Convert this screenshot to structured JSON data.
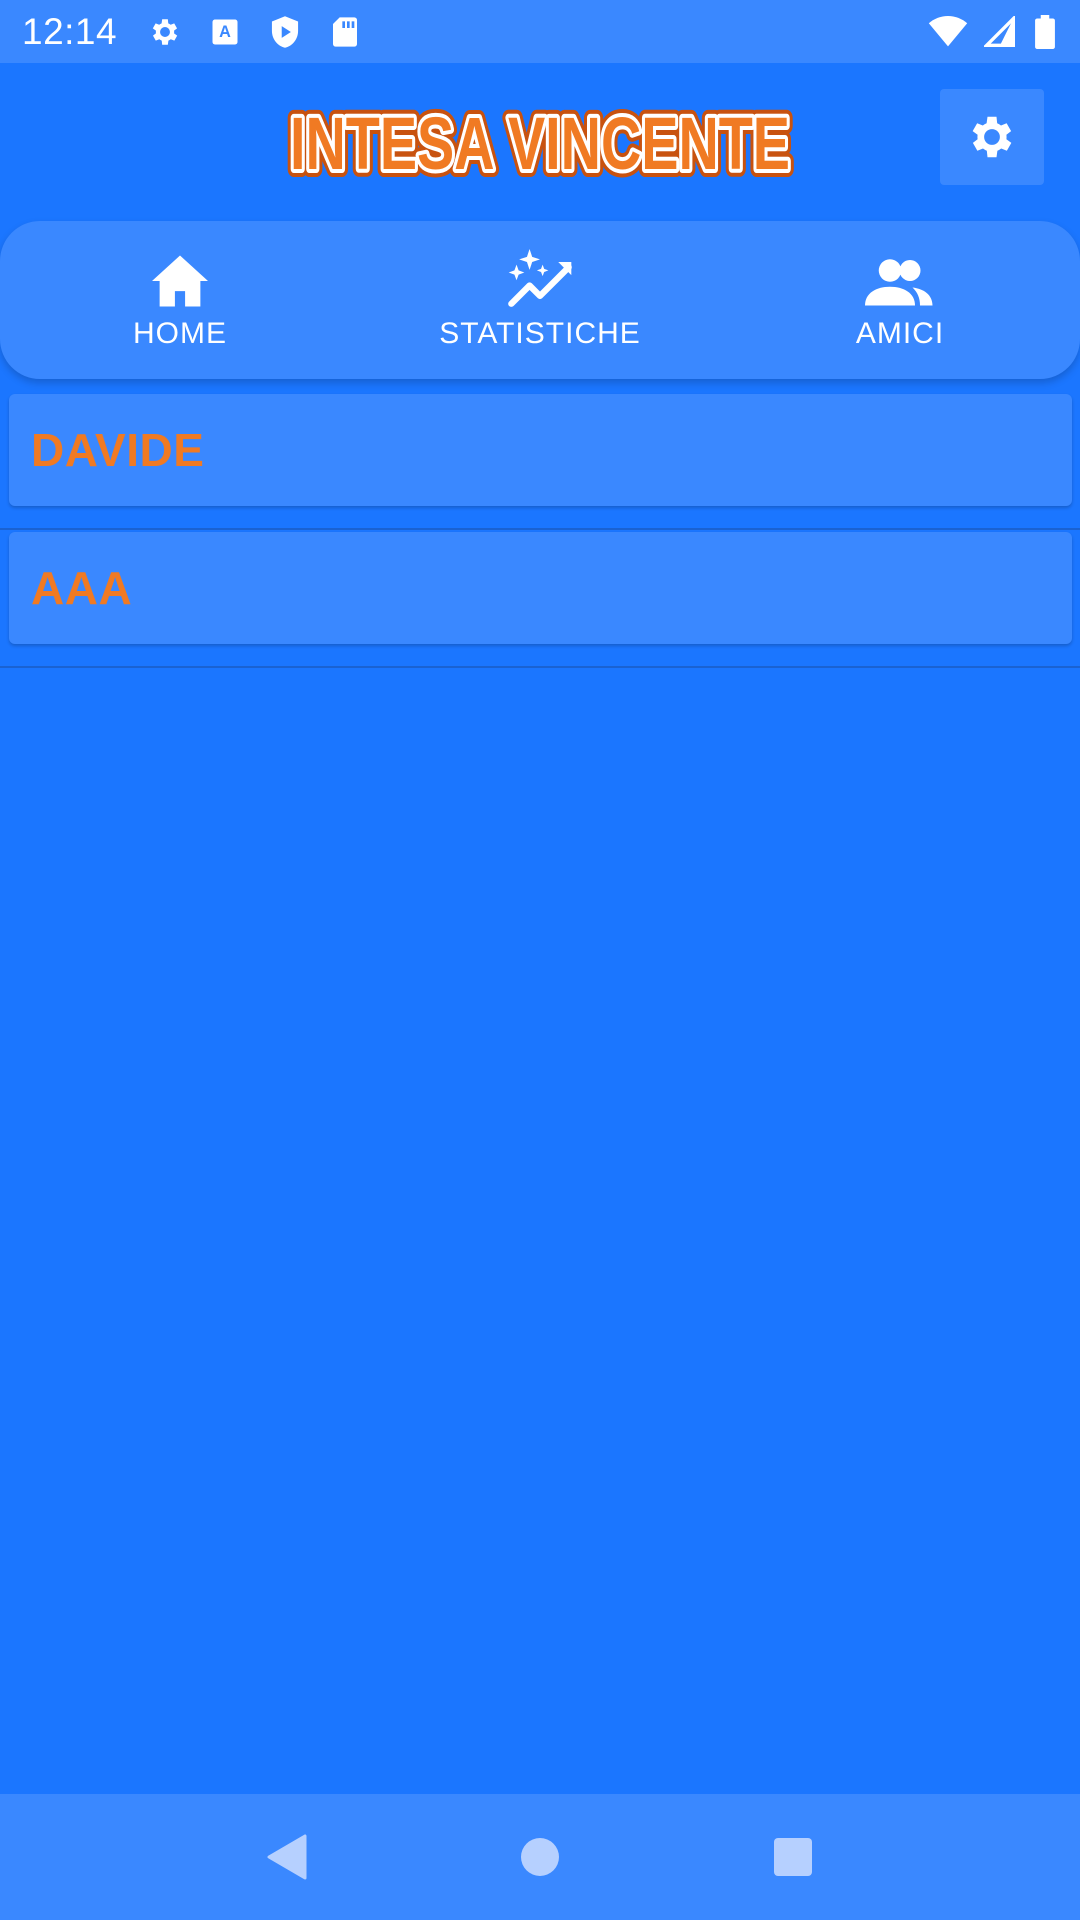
{
  "status_bar": {
    "time": "12:14",
    "icons_left": [
      "settings-icon",
      "font-download-icon",
      "play-protect-icon",
      "sd-card-icon"
    ],
    "icons_right": [
      "wifi-icon",
      "cell-signal-icon",
      "battery-icon"
    ]
  },
  "app": {
    "logo_text": "INTESA VINCENTE",
    "logo_colors": {
      "fill": "#f07a23",
      "outline": "#ffffff",
      "inner_outline": "#c8520f"
    }
  },
  "tabs": [
    {
      "label": "HOME",
      "icon": "home-icon"
    },
    {
      "label": "STATISTICHE",
      "icon": "stats-sparkle-icon"
    },
    {
      "label": "AMICI",
      "icon": "people-icon"
    }
  ],
  "friends": [
    {
      "name": "DAVIDE"
    },
    {
      "name": "AAA"
    }
  ],
  "colors": {
    "background": "#1b76ff",
    "surface": "#3a88ff",
    "accent": "#f07a23",
    "text": "#ffffff"
  },
  "nav_bar": [
    "back-icon",
    "home-circle-icon",
    "recents-icon"
  ]
}
